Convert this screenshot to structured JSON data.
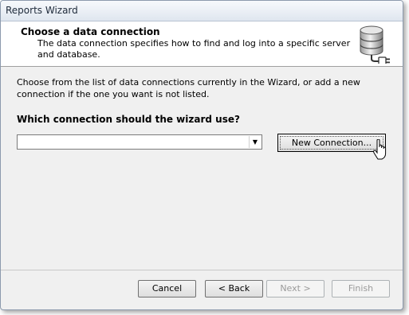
{
  "window": {
    "title": "Reports Wizard"
  },
  "header": {
    "title": "Choose a data connection",
    "description": "The data connection specifies how to find and log into a specific server and database.",
    "icon": "database-plug-icon"
  },
  "main": {
    "instructions": "Choose from the list of data connections currently in the Wizard, or add a new connection if the one you want is not listed.",
    "question": "Which connection should the wizard use?",
    "connection_select": {
      "value": "",
      "icon": "chevron-down-icon"
    },
    "new_connection_label": "New Connection..."
  },
  "footer": {
    "cancel_label": "Cancel",
    "back_label": "< Back",
    "next_label": "Next >",
    "finish_label": "Finish"
  },
  "colors": {
    "header_bg": "#ffffff",
    "body_bg": "#f0f0f0",
    "disabled_text": "#9a9a9a"
  }
}
